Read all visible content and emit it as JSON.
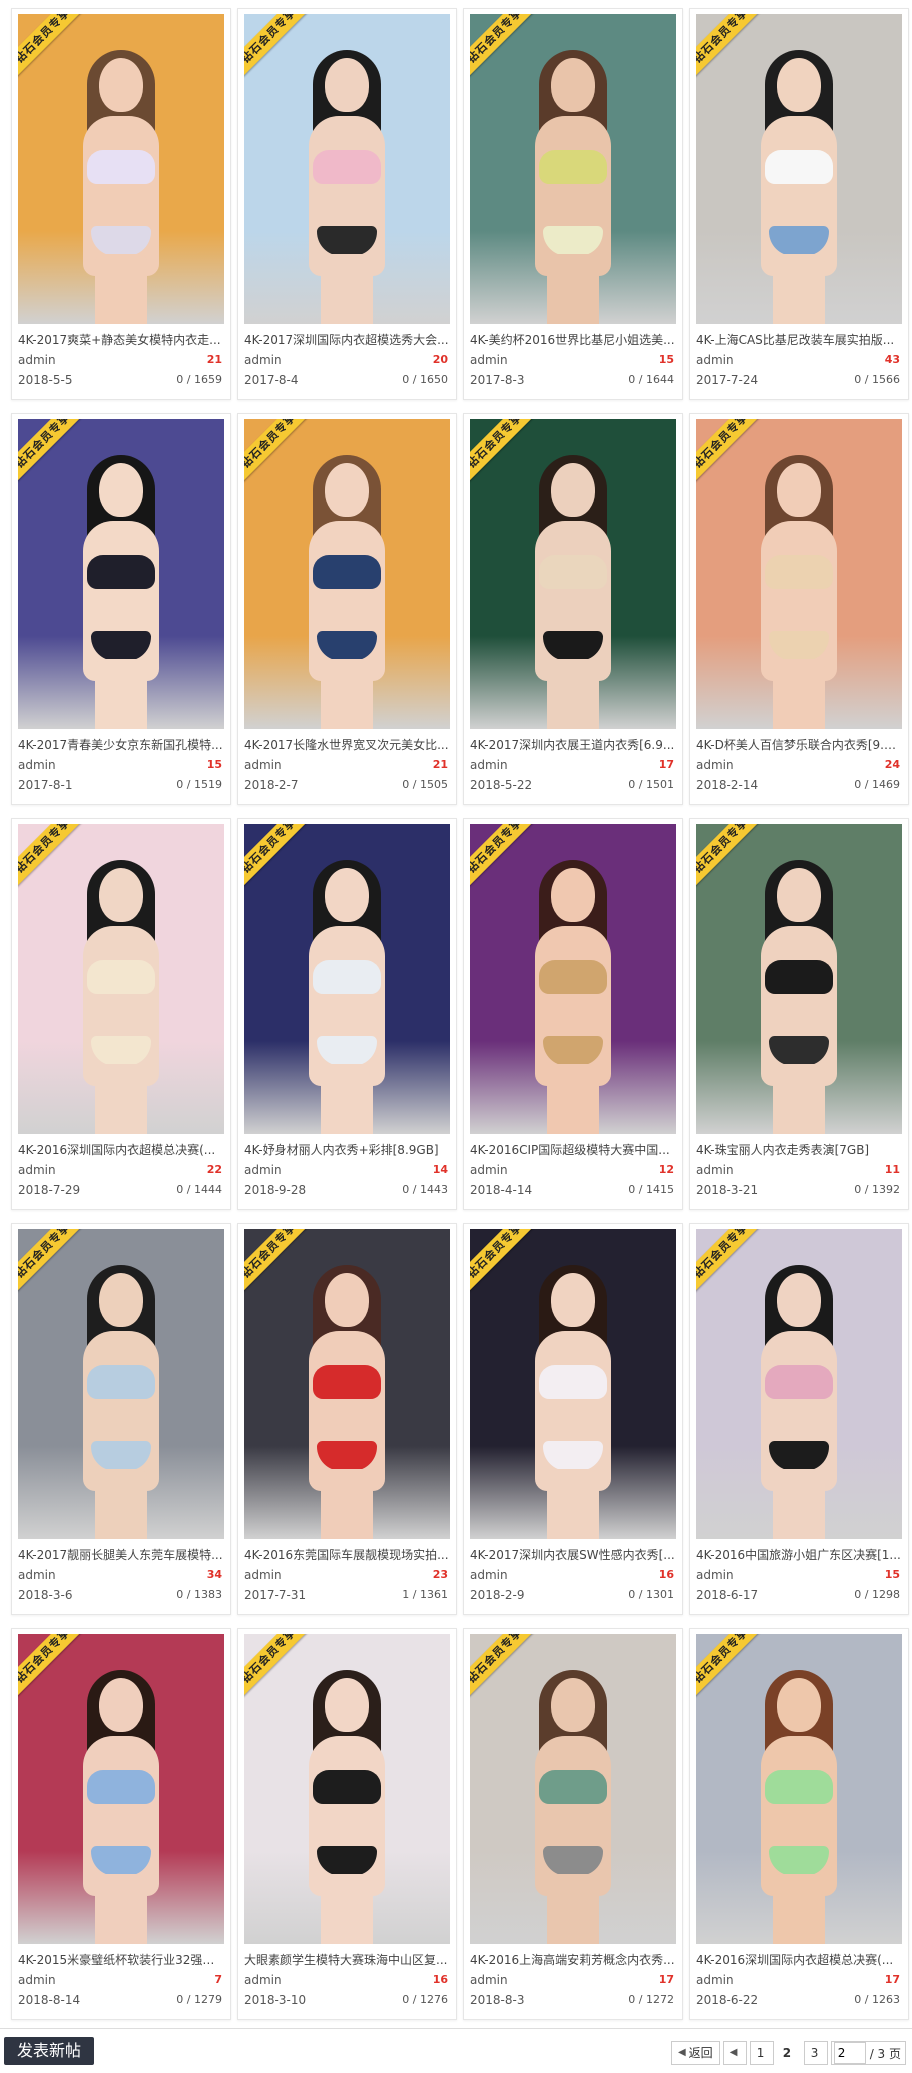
{
  "ribbon_label": "钻石会员专享",
  "cards": [
    {
      "title": "4K-2017爽菜+静态美女模特内衣走...",
      "author": "admin",
      "replies": "21",
      "date": "2018-5-5",
      "views": "0 / 1659"
    },
    {
      "title": "4K-2017深圳国际内衣超模选秀大会...",
      "author": "admin",
      "replies": "20",
      "date": "2017-8-4",
      "views": "0 / 1650"
    },
    {
      "title": "4K-美约杯2016世界比基尼小姐选美...",
      "author": "admin",
      "replies": "15",
      "date": "2017-8-3",
      "views": "0 / 1644"
    },
    {
      "title": "4K-上海CAS比基尼改装车展实拍版...",
      "author": "admin",
      "replies": "43",
      "date": "2017-7-24",
      "views": "0 / 1566"
    },
    {
      "title": "4K-2017青春美少女京东新国孔模特...",
      "author": "admin",
      "replies": "15",
      "date": "2017-8-1",
      "views": "0 / 1519"
    },
    {
      "title": "4K-2017长隆水世界宽叉次元美女比...",
      "author": "admin",
      "replies": "21",
      "date": "2018-2-7",
      "views": "0 / 1505"
    },
    {
      "title": "4K-2017深圳内衣展王道内衣秀[6.9...",
      "author": "admin",
      "replies": "17",
      "date": "2018-5-22",
      "views": "0 / 1501"
    },
    {
      "title": "4K-D杯美人百信梦乐联合内衣秀[9.5...",
      "author": "admin",
      "replies": "24",
      "date": "2018-2-14",
      "views": "0 / 1469"
    },
    {
      "title": "4K-2016深圳国际内衣超模总决赛(...",
      "author": "admin",
      "replies": "22",
      "date": "2018-7-29",
      "views": "0 / 1444"
    },
    {
      "title": "4K-妤身材丽人内衣秀+彩排[8.9GB]",
      "author": "admin",
      "replies": "14",
      "date": "2018-9-28",
      "views": "0 / 1443"
    },
    {
      "title": "4K-2016CIP国际超级模特大赛中国...",
      "author": "admin",
      "replies": "12",
      "date": "2018-4-14",
      "views": "0 / 1415"
    },
    {
      "title": "4K-珠宝丽人内衣走秀表演[7GB]",
      "author": "admin",
      "replies": "11",
      "date": "2018-3-21",
      "views": "0 / 1392"
    },
    {
      "title": "4K-2017靓丽长腿美人东莞车展模特...",
      "author": "admin",
      "replies": "34",
      "date": "2018-3-6",
      "views": "0 / 1383"
    },
    {
      "title": "4K-2016东莞国际车展靓模现场实拍...",
      "author": "admin",
      "replies": "23",
      "date": "2017-7-31",
      "views": "1 / 1361"
    },
    {
      "title": "4K-2017深圳内衣展SW性感内衣秀[...",
      "author": "admin",
      "replies": "16",
      "date": "2018-2-9",
      "views": "0 / 1301"
    },
    {
      "title": "4K-2016中国旅游小姐广东区决赛[1...",
      "author": "admin",
      "replies": "15",
      "date": "2018-6-17",
      "views": "0 / 1298"
    },
    {
      "title": "4K-2015米豪璧纸杯软装行业32强佳...",
      "author": "admin",
      "replies": "7",
      "date": "2018-8-14",
      "views": "0 / 1279"
    },
    {
      "title": "大眼素颜学生模特大赛珠海中山区复...",
      "author": "admin",
      "replies": "16",
      "date": "2018-3-10",
      "views": "0 / 1276"
    },
    {
      "title": "4K-2016上海高端安莉芳概念内衣秀...",
      "author": "admin",
      "replies": "17",
      "date": "2018-8-3",
      "views": "0 / 1272"
    },
    {
      "title": "4K-2016深圳国际内衣超模总决赛(...",
      "author": "admin",
      "replies": "17",
      "date": "2018-6-22",
      "views": "0 / 1263"
    }
  ],
  "photo_palettes": [
    {
      "bg": "#e9a84a",
      "hair": "#6b4a32",
      "skin": "#f1cdb6",
      "top": "#e7e0f4",
      "bottom": "#ddd9e8"
    },
    {
      "bg": "#bcd6ea",
      "hair": "#1c1c1c",
      "skin": "#efd2c0",
      "top": "#f0b9c9",
      "bottom": "#2a2a2a"
    },
    {
      "bg": "#5d8a82",
      "hair": "#5a3b2a",
      "skin": "#e9c4aa",
      "top": "#d9d87a",
      "bottom": "#ecebc8"
    },
    {
      "bg": "#c9c6c1",
      "hair": "#1e1e1e",
      "skin": "#f0d3bf",
      "top": "#f7f7f7",
      "bottom": "#7da4cf"
    },
    {
      "bg": "#4d4a92",
      "hair": "#161616",
      "skin": "#f3d9c7",
      "top": "#1f1f2b",
      "bottom": "#1f1f2b"
    },
    {
      "bg": "#e8a54a",
      "hair": "#7a5236",
      "skin": "#f2d3c0",
      "top": "#28406e",
      "bottom": "#28406e"
    },
    {
      "bg": "#1f4f3a",
      "hair": "#2b1f18",
      "skin": "#ecd0bd",
      "top": "#ead6bd",
      "bottom": "#1a1a1a"
    },
    {
      "bg": "#e49e7e",
      "hair": "#6e4630",
      "skin": "#f1cdb7",
      "top": "#ecd2b0",
      "bottom": "#ecd2b0"
    },
    {
      "bg": "#f0d5dd",
      "hair": "#1b1b1b",
      "skin": "#f0d6c5",
      "top": "#f3e6cf",
      "bottom": "#f3e6cf"
    },
    {
      "bg": "#2c2f68",
      "hair": "#1a1a1a",
      "skin": "#f2d6c5",
      "top": "#e9edf2",
      "bottom": "#e9edf2"
    },
    {
      "bg": "#6a2f7a",
      "hair": "#3b1d1a",
      "skin": "#f0c8b0",
      "top": "#d0a56e",
      "bottom": "#d0a56e"
    },
    {
      "bg": "#5f7e67",
      "hair": "#1b1b1b",
      "skin": "#efd2bf",
      "top": "#1b1b1b",
      "bottom": "#2d2d2d"
    },
    {
      "bg": "#8a8f98",
      "hair": "#1e1e1e",
      "skin": "#edd0bb",
      "top": "#b7cde0",
      "bottom": "#b7cde0"
    },
    {
      "bg": "#3a3a44",
      "hair": "#4a2a24",
      "skin": "#f0cdb9",
      "top": "#d62b2b",
      "bottom": "#d62b2b"
    },
    {
      "bg": "#232130",
      "hair": "#2a1a14",
      "skin": "#f0d3c1",
      "top": "#f3eef2",
      "bottom": "#f3eef2"
    },
    {
      "bg": "#cfc8d7",
      "hair": "#1a1a1a",
      "skin": "#efd3c2",
      "top": "#e4a9be",
      "bottom": "#1c1c1c"
    },
    {
      "bg": "#b43a55",
      "hair": "#2a1a14",
      "skin": "#f0cfbd",
      "top": "#8fb3dd",
      "bottom": "#8fb3dd"
    },
    {
      "bg": "#e8e2e6",
      "hair": "#2b1f1a",
      "skin": "#f2d6c6",
      "top": "#1d1d1d",
      "bottom": "#1d1d1d"
    },
    {
      "bg": "#cfc9c3",
      "hair": "#5b3d2c",
      "skin": "#e9c6ae",
      "top": "#6f9d8a",
      "bottom": "#8c8c8c"
    },
    {
      "bg": "#b2b8c4",
      "hair": "#7a4127",
      "skin": "#eec7ab",
      "top": "#9fdc9a",
      "bottom": "#9fdc9a"
    }
  ],
  "footer": {
    "post_button": "发表新帖",
    "pagination": {
      "back": "返回",
      "pages": [
        "1",
        "2",
        "3"
      ],
      "current": "2",
      "input_value": "2",
      "total": "/ 3 页"
    }
  }
}
